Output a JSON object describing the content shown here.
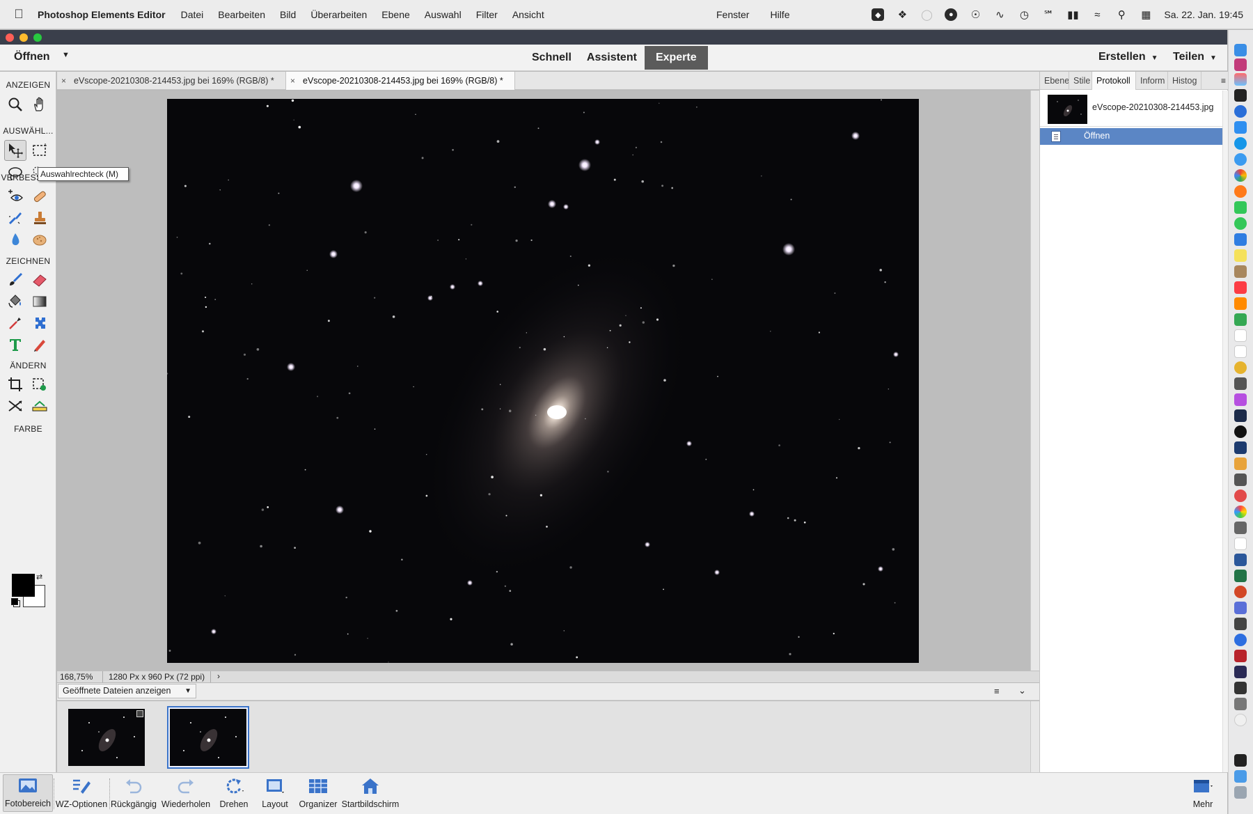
{
  "menubar": {
    "app_name": "Photoshop Elements Editor",
    "items": [
      "Datei",
      "Bearbeiten",
      "Bild",
      "Überarbeiten",
      "Ebene",
      "Auswahl",
      "Filter",
      "Ansicht"
    ],
    "right_items": [
      "Fenster",
      "Hilfe"
    ],
    "clock": "Sa. 22. Jan.  19:45"
  },
  "header": {
    "open_label": "Öffnen",
    "modes": [
      "Schnell",
      "Assistent",
      "Experte"
    ],
    "active_mode": "Experte",
    "create_label": "Erstellen",
    "share_label": "Teilen"
  },
  "toolbox": {
    "sections": [
      "ANZEIGEN",
      "AUSWÄHL...",
      "VERBESSE...",
      "ZEICHNEN",
      "ÄNDERN",
      "FARBE"
    ],
    "tooltip": "Auswahlrechteck (M)"
  },
  "document_tabs": [
    {
      "label": "eVscope-20210308-214453.jpg bei 169% (RGB/8) *",
      "active": false
    },
    {
      "label": "eVscope-20210308-214453.jpg bei 169% (RGB/8) *",
      "active": true
    }
  ],
  "status": {
    "zoom": "168,75%",
    "size": "1280 Px x 960 Px (72 ppi)"
  },
  "photo_bin": {
    "selector_label": "Geöffnete Dateien anzeigen"
  },
  "panel": {
    "tabs": [
      "Ebene",
      "Stile",
      "Protokoll",
      "Inform",
      "Histog"
    ],
    "active_tab": "Protokoll",
    "file_name": "eVscope-20210308-214453.jpg",
    "history_steps": [
      "Öffnen"
    ]
  },
  "taskbar": {
    "buttons": [
      "Fotobereich",
      "WZ-Optionen",
      "Rückgängig",
      "Wiederholen",
      "Drehen",
      "Layout",
      "Organizer",
      "Startbildschirm"
    ],
    "more_label": "Mehr"
  },
  "colors": {
    "accent": "#5b86c5",
    "mode_active_bg": "#5b5b5b",
    "canvas_bg": "#bdbdbd"
  }
}
